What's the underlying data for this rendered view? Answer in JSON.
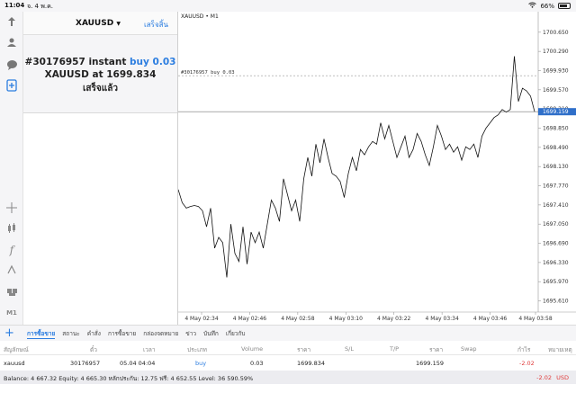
{
  "status": {
    "time": "11:04",
    "date": "จ. 4 พ.ค.",
    "battery": "66%"
  },
  "order_panel": {
    "symbol": "XAUUSD",
    "done_label": "เสร็จสิ้น",
    "order_ref": "#30176957 instant",
    "order_type": "buy 0.03",
    "line2": "XAUUSD at 1699.834",
    "status_text": "เสร็จแล้ว"
  },
  "chart": {
    "title": "XAUUSD • M1",
    "order_line_label": "#30176957 buy 0.03",
    "current_price": "1699.159"
  },
  "chart_data": {
    "type": "line",
    "symbol": "XAUUSD",
    "timeframe": "M1",
    "price_ticks": [
      "1700.650",
      "1700.290",
      "1699.930",
      "1699.570",
      "1699.210",
      "1698.850",
      "1698.490",
      "1698.130",
      "1697.770",
      "1697.410",
      "1697.050",
      "1696.690",
      "1696.330",
      "1695.970",
      "1695.610"
    ],
    "time_ticks": [
      "4 May 02:34",
      "4 May 02:46",
      "4 May 02:58",
      "4 May 03:10",
      "4 May 03:22",
      "4 May 03:34",
      "4 May 03:46",
      "4 May 03:58"
    ],
    "ylim": [
      1695.4,
      1700.9
    ],
    "order_price": 1699.834,
    "current_price": 1699.159,
    "values": [
      1697.7,
      1697.45,
      1697.35,
      1697.38,
      1697.4,
      1697.38,
      1697.3,
      1697.0,
      1697.35,
      1696.6,
      1696.8,
      1696.7,
      1696.05,
      1697.05,
      1696.5,
      1696.35,
      1697.0,
      1696.3,
      1696.9,
      1696.7,
      1696.9,
      1696.6,
      1697.05,
      1697.5,
      1697.35,
      1697.1,
      1697.9,
      1697.6,
      1697.3,
      1697.5,
      1697.1,
      1697.9,
      1698.3,
      1697.95,
      1698.55,
      1698.2,
      1698.65,
      1698.3,
      1698.0,
      1697.95,
      1697.85,
      1697.55,
      1698.0,
      1698.3,
      1698.05,
      1698.45,
      1698.35,
      1698.5,
      1698.6,
      1698.55,
      1698.95,
      1698.65,
      1698.9,
      1698.6,
      1698.3,
      1698.5,
      1698.7,
      1698.3,
      1698.45,
      1698.75,
      1698.6,
      1698.35,
      1698.15,
      1698.5,
      1698.9,
      1698.7,
      1698.45,
      1698.55,
      1698.4,
      1698.5,
      1698.25,
      1698.5,
      1698.45,
      1698.55,
      1698.3,
      1698.7,
      1698.85,
      1698.95,
      1699.05,
      1699.1,
      1699.2,
      1699.15,
      1699.2,
      1700.2,
      1699.35,
      1699.6,
      1699.55,
      1699.45,
      1699.16
    ]
  },
  "tabs": {
    "plus": "+",
    "items": [
      "การซื้อขาย",
      "สถานะ",
      "คำสั่ง",
      "การซื้อขาย",
      "กล่องจดหมาย",
      "ข่าว",
      "บันทึก",
      "เกี่ยวกับ"
    ]
  },
  "table": {
    "headers": [
      "สัญลักษณ์",
      "ตั๋ว",
      "เวลา",
      "ประเภท",
      "Volume",
      "ราคา",
      "S/L",
      "T/P",
      "ราคา",
      "Swap",
      "กำไร",
      "หมายเหตุ"
    ],
    "row": {
      "symbol": "xauusd",
      "ticket": "30176957",
      "time": "05.04 04:04",
      "type": "buy",
      "volume": "0.03",
      "open_price": "1699.834",
      "current_price": "1699.159",
      "profit": "-2.02"
    }
  },
  "balance": {
    "text": "Balance: 4 667.32 Equity: 4 665.30 หลักประกัน: 12.75 ฟรี: 4 652.55 Level: 36 590.59%",
    "total": "-2.02",
    "currency": "USD"
  },
  "colors": {
    "accent": "#2b7de0",
    "negative": "#e03b3b",
    "line": "#111111"
  }
}
